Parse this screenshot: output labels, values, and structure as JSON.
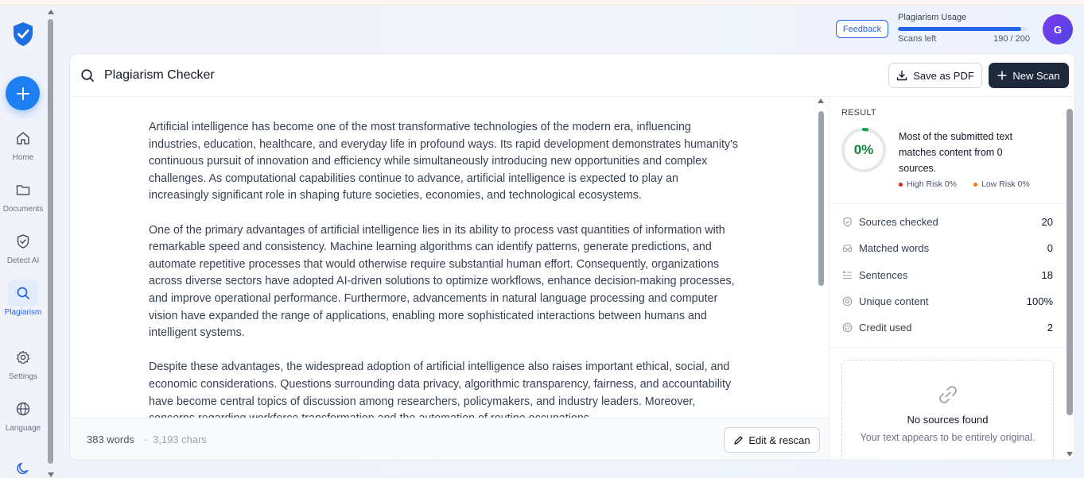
{
  "sidebar": {
    "items": [
      {
        "label": "Home",
        "icon": "home-icon"
      },
      {
        "label": "Documents",
        "icon": "folder-icon"
      },
      {
        "label": "Detect AI",
        "icon": "shield-check-icon"
      },
      {
        "label": "Plagiarism",
        "icon": "search-icon"
      },
      {
        "label": "Settings",
        "icon": "gear-icon"
      },
      {
        "label": "Language",
        "icon": "globe-icon"
      }
    ]
  },
  "header": {
    "feedback_label": "Feedback",
    "usage_title": "Plagiarism Usage",
    "scans_left_label": "Scans left",
    "scans_count": "190 / 200",
    "scans_fraction": 0.95,
    "avatar_initial": "G"
  },
  "card": {
    "title": "Plagiarism Checker",
    "save_pdf_label": "Save as PDF",
    "new_scan_label": "New Scan"
  },
  "document": {
    "paragraphs": [
      "Artificial intelligence has become one of the most transformative technologies of the modern era, influencing industries, education, healthcare, and everyday life in profound ways. Its rapid development demonstrates humanity's continuous pursuit of innovation and efficiency while simultaneously introducing new opportunities and complex challenges. As computational capabilities continue to advance, artificial intelligence is expected to play an increasingly significant role in shaping future societies, economies, and technological ecosystems.",
      "One of the primary advantages of artificial intelligence lies in its ability to process vast quantities of information with remarkable speed and consistency. Machine learning algorithms can identify patterns, generate predictions, and automate repetitive processes that would otherwise require substantial human effort. Consequently, organizations across diverse sectors have adopted AI-driven solutions to optimize workflows, enhance decision-making processes, and improve operational performance. Furthermore, advancements in natural language processing and computer vision have expanded the range of applications, enabling more sophisticated interactions between humans and intelligent systems.",
      "Despite these advantages, the widespread adoption of artificial intelligence also raises important ethical, social, and economic considerations. Questions surrounding data privacy, algorithmic transparency, fairness, and accountability have become central topics of discussion among researchers, policymakers, and industry leaders. Moreover, concerns regarding workforce transformation and the automation of routine occupations"
    ],
    "word_count": "383 words",
    "separator": "·",
    "char_count": "3,193 chars",
    "edit_label": "Edit & rescan"
  },
  "result": {
    "label": "RESULT",
    "percent": "0%",
    "percent_value": 0,
    "message": "Most of the submitted text matches content from 0 sources.",
    "high_risk": "High Risk 0%",
    "low_risk": "Low Risk 0%",
    "stats": [
      {
        "label": "Sources checked",
        "value": "20",
        "icon": "shield-icon"
      },
      {
        "label": "Matched words",
        "value": "0",
        "icon": "glasses-icon"
      },
      {
        "label": "Sentences",
        "value": "18",
        "icon": "text-lines-icon"
      },
      {
        "label": "Unique content",
        "value": "100%",
        "icon": "circle-dot-icon"
      },
      {
        "label": "Credit used",
        "value": "2",
        "icon": "coin-icon"
      }
    ],
    "no_sources_title": "No sources found",
    "no_sources_sub": "Your text appears to be entirely original."
  },
  "colors": {
    "accent": "#2563eb",
    "fab": "#1d7ff2",
    "dark_button": "#1e293b",
    "success": "#15803d",
    "high_risk": "#dc2626",
    "low_risk": "#f97316"
  }
}
